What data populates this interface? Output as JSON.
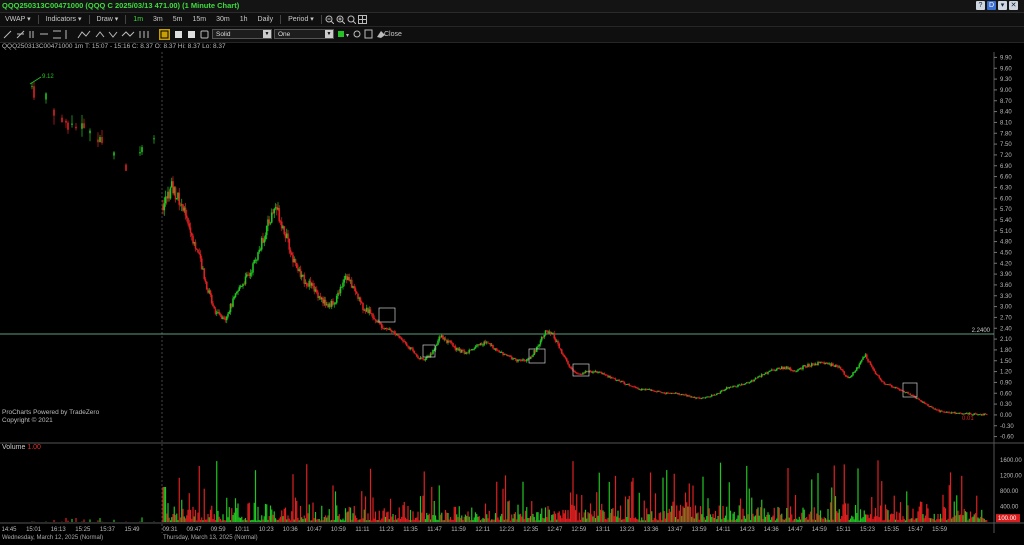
{
  "window": {
    "title": "QQQ250313C00471000 (QQQ C 2025/03/13 471.00) (1 Minute Chart)",
    "controls": [
      "?",
      "D",
      "▾",
      "✕"
    ]
  },
  "toolbar": {
    "vwap": "VWAP ▾",
    "indicators": "Indicators ▾",
    "draw": "Draw ▾",
    "timeframes": [
      "1m",
      "3m",
      "5m",
      "15m",
      "30m",
      "1h",
      "Daily"
    ],
    "active_timeframe": "1m",
    "period": "Period ▾"
  },
  "drawbar": {
    "line_style": "Solid",
    "line_width": "One",
    "close": "Close"
  },
  "info": {
    "symbol": "QQQ250313C00471000 1m",
    "time": "T: 15:07 - 15:16",
    "close": "C: 8.37",
    "open": "O: 8.37",
    "high": "Hi: 8.37",
    "low": "Lo: 8.37"
  },
  "branding": {
    "line1": "ProCharts Powered by TradeZero",
    "line2": "Copyright © 2021"
  },
  "volume_panel": {
    "label": "Volume",
    "value": "1.00",
    "marker": "100.00"
  },
  "date_labels": {
    "left": "Wednesday, March 12, 2025 (Normal)",
    "right": "Thursday, March 13, 2025 (Normal)"
  },
  "colors": {
    "up": "#22c422",
    "down": "#e02020",
    "title": "#3fdc3f"
  },
  "chart_data": {
    "type": "candlestick",
    "y_ticks": [
      "9.90",
      "9.60",
      "9.30",
      "9.00",
      "8.70",
      "8.40",
      "8.10",
      "7.80",
      "7.50",
      "7.20",
      "6.90",
      "6.60",
      "6.30",
      "6.00",
      "5.70",
      "5.40",
      "5.10",
      "4.80",
      "4.50",
      "4.20",
      "3.90",
      "3.60",
      "3.30",
      "3.00",
      "2.70",
      "2.40",
      "2.10",
      "1.80",
      "1.50",
      "1.20",
      "0.90",
      "0.60",
      "0.30",
      "0.00",
      "-0.30",
      "-0.60"
    ],
    "ylim": [
      -0.75,
      10.05
    ],
    "vol_ticks": [
      "1600.00",
      "1200.00",
      "800.00",
      "400.00"
    ],
    "vol_max": 1800,
    "x_ticks": [
      "14:45",
      "15:01",
      "16:13",
      "15:25",
      "15:37",
      "15:49",
      "09:31",
      "09:47",
      "09:59",
      "10:11",
      "10:23",
      "10:36",
      "10:47",
      "10:59",
      "11:11",
      "11:23",
      "11:35",
      "11:47",
      "11:59",
      "12:11",
      "12:23",
      "12:35",
      "12:47",
      "12:59",
      "13:11",
      "13:23",
      "13:36",
      "13:47",
      "13:59",
      "14:11",
      "14:23",
      "14:36",
      "14:47",
      "14:59",
      "15:11",
      "15:23",
      "15:35",
      "15:47",
      "15:59"
    ],
    "horizontal_line": {
      "value": 2.24,
      "label": "2.2400"
    },
    "high_label": "9.12",
    "low_label": "0.01",
    "day1_path": [
      9.0,
      9.12,
      8.9,
      8.5,
      8.2,
      8.0,
      7.9,
      7.7,
      7.4,
      7.1,
      6.9,
      7.2,
      7.5,
      7.8
    ],
    "day2_path": [
      5.8,
      6.3,
      5.9,
      5.2,
      4.5,
      3.6,
      2.9,
      2.6,
      3.1,
      3.6,
      3.9,
      4.5,
      5.2,
      5.8,
      5.1,
      4.3,
      3.8,
      3.6,
      3.3,
      3.0,
      3.2,
      3.9,
      3.5,
      3.0,
      2.8,
      2.5,
      2.4,
      2.2,
      2.0,
      1.7,
      1.5,
      1.7,
      2.2,
      2.0,
      1.8,
      1.7,
      1.9,
      2.0,
      1.9,
      1.7,
      1.6,
      1.5,
      1.5,
      1.8,
      2.3,
      2.2,
      1.7,
      1.3,
      1.1,
      1.2,
      1.2,
      1.1,
      1.0,
      0.9,
      0.8,
      0.7,
      0.7,
      0.65,
      0.6,
      0.6,
      0.55,
      0.5,
      0.45,
      0.5,
      0.6,
      0.75,
      0.8,
      0.85,
      0.95,
      1.1,
      1.2,
      1.3,
      1.3,
      1.2,
      1.35,
      1.4,
      1.45,
      1.4,
      1.3,
      1.0,
      1.3,
      1.65,
      1.2,
      0.9,
      0.8,
      0.7,
      0.6,
      0.45,
      0.3,
      0.15,
      0.08,
      0.05,
      0.04,
      0.03,
      0.02,
      0.01
    ]
  }
}
